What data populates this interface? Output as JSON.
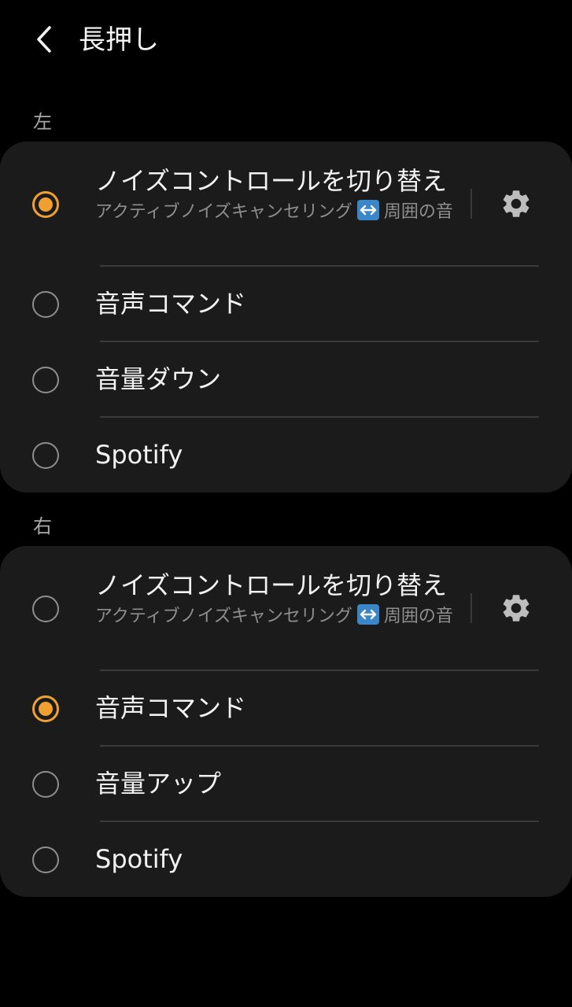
{
  "header": {
    "title": "長押し",
    "back_icon": "chevron-left-icon"
  },
  "accent_color": "#f0a030",
  "sections": [
    {
      "label": "左",
      "options": [
        {
          "title": "ノイズコントロールを切り替え",
          "subtitle_a": "アクティブノイズキャンセリング",
          "subtitle_icon": "left-right-arrow-icon",
          "subtitle_b": "周囲の音",
          "settings_icon": "gear-icon",
          "selected": true
        },
        {
          "title": "音声コマンド",
          "selected": false
        },
        {
          "title": "音量ダウン",
          "selected": false
        },
        {
          "title": "Spotify",
          "selected": false
        }
      ]
    },
    {
      "label": "右",
      "options": [
        {
          "title": "ノイズコントロールを切り替え",
          "subtitle_a": "アクティブノイズキャンセリング",
          "subtitle_icon": "left-right-arrow-icon",
          "subtitle_b": "周囲の音",
          "settings_icon": "gear-icon",
          "selected": false
        },
        {
          "title": "音声コマンド",
          "selected": true
        },
        {
          "title": "音量アップ",
          "selected": false
        },
        {
          "title": "Spotify",
          "selected": false
        }
      ]
    }
  ]
}
